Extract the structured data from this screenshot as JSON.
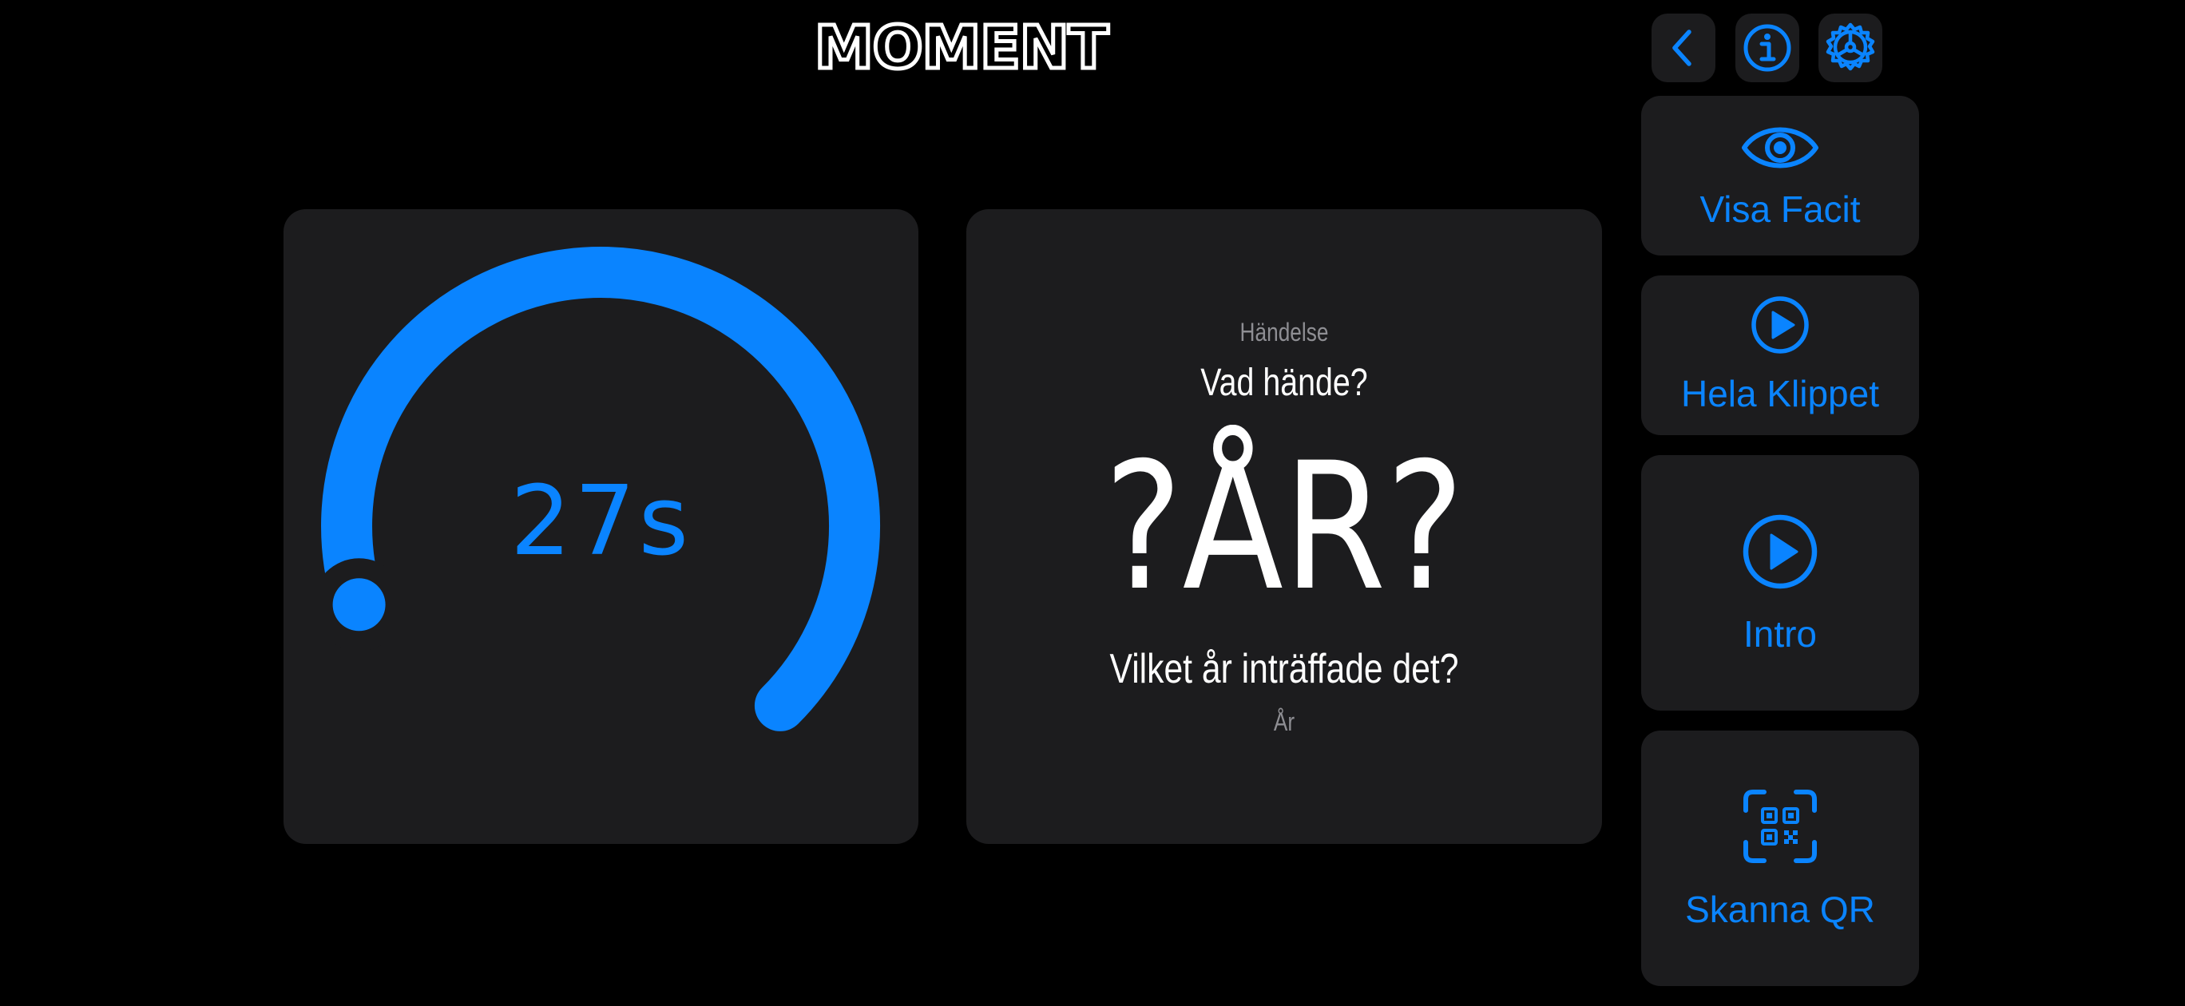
{
  "app": {
    "logo_text": "MOMENT"
  },
  "toolbar": {
    "back_icon": "chevron-left-icon",
    "info_icon": "info-circle-icon",
    "settings_icon": "gear-icon"
  },
  "timer": {
    "display": "27s",
    "remaining_fraction": 0.9
  },
  "question": {
    "category": "Händelse",
    "title": "Vad hände?",
    "answer_placeholder": "?ÅR?",
    "prompt": "Vilket år inträffade det?",
    "unit": "År"
  },
  "actions": {
    "show_answer": {
      "label": "Visa Facit",
      "icon": "eye-icon"
    },
    "full_clip": {
      "label": "Hela Klippet",
      "icon": "play-circle-icon"
    },
    "intro": {
      "label": "Intro",
      "icon": "play-circle-icon"
    },
    "scan_qr": {
      "label": "Skanna QR",
      "icon": "qr-scan-icon"
    }
  },
  "colors": {
    "accent": "#0a84ff",
    "card": "#1c1c1e",
    "background": "#000000",
    "secondary_text": "#8e8e93"
  }
}
